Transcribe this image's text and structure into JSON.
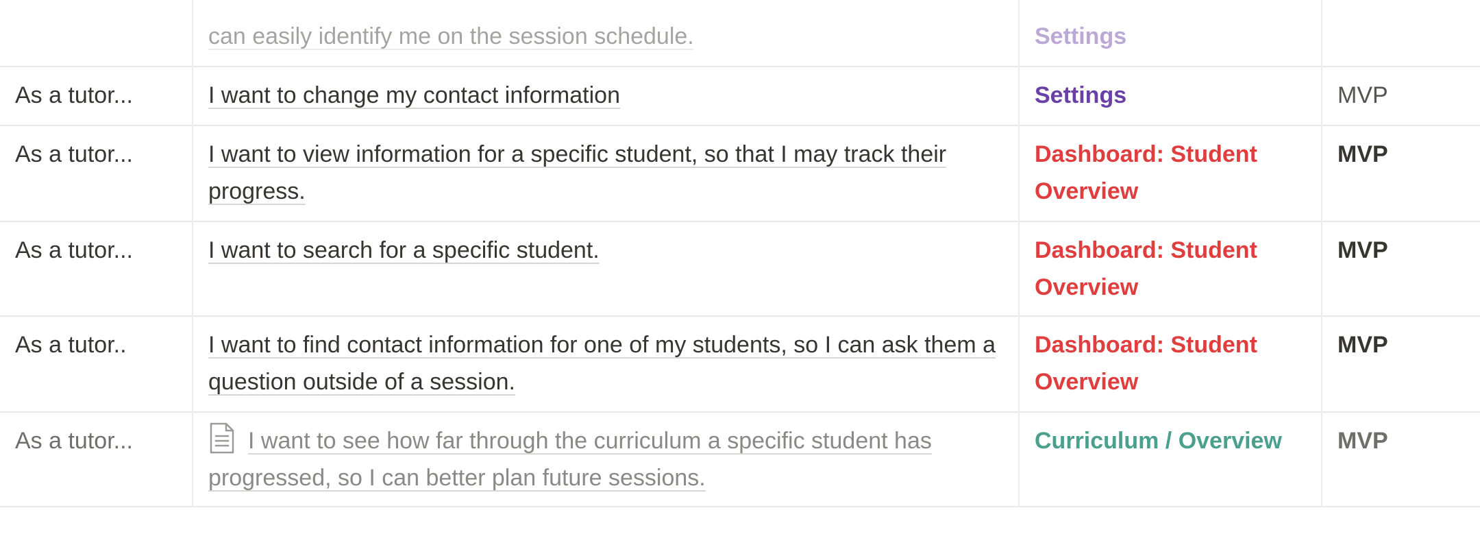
{
  "colors": {
    "settings_purple": "#6940a5",
    "dashboard_red": "#e03e3e",
    "curriculum_teal": "#4b9f8d",
    "text": "#37352f",
    "divider": "#e9e9e7"
  },
  "rows": [
    {
      "persona": "",
      "story": "can easily identify me on the session schedule.",
      "feature": "Settings",
      "priority": ""
    },
    {
      "persona": "As a tutor...",
      "story": "I want to change my contact information",
      "feature": "Settings",
      "priority": "MVP"
    },
    {
      "persona": "As a tutor...",
      "story": "I want to view information for a specific student, so that I may track their progress.",
      "feature": "Dashboard: Student Overview",
      "priority": "MVP"
    },
    {
      "persona": "As a tutor...",
      "story": "I want to search for a specific student.",
      "feature": "Dashboard: Student Overview",
      "priority": "MVP"
    },
    {
      "persona": "As a tutor..",
      "story": "I want to find contact information for one of my students, so I can ask them a question outside of a session.",
      "feature": "Dashboard: Student Overview",
      "priority": "MVP"
    },
    {
      "persona": "As a tutor...",
      "story": "I want to see how far through the curriculum a specific student has progressed, so I can better plan future sessions.",
      "feature": "Curriculum / Overview",
      "priority": "MVP",
      "icon": "page-icon"
    }
  ]
}
